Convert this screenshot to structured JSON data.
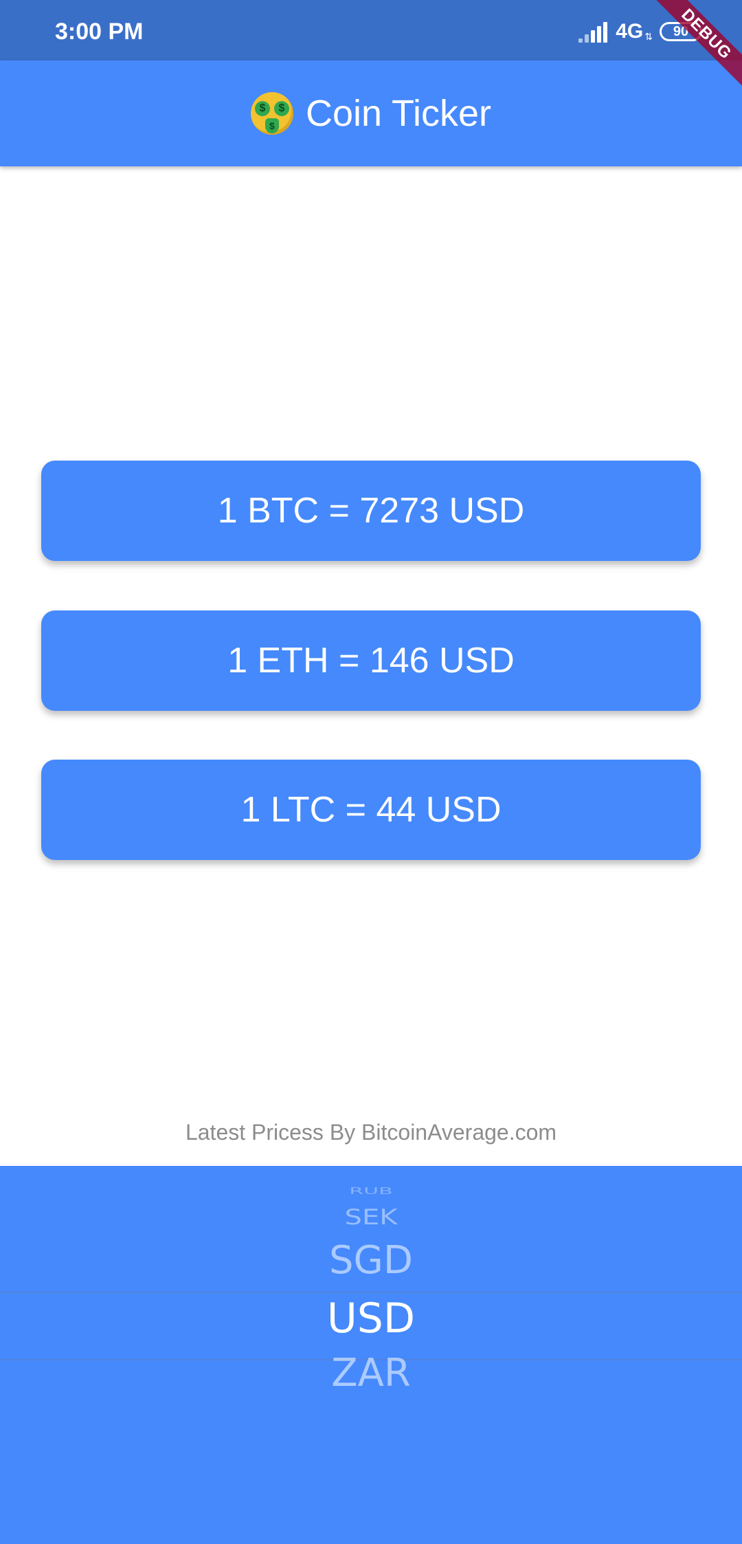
{
  "status_bar": {
    "time": "3:00 PM",
    "network": "4G",
    "battery": "90",
    "icons": [
      "signal-icon",
      "data-arrows-icon",
      "battery-icon"
    ]
  },
  "debug_banner": {
    "label": "DEBUG"
  },
  "app_bar": {
    "emoji": "money-mouth-face-icon",
    "title": "Coin Ticker"
  },
  "rates": [
    {
      "label": "1 BTC = 7273 USD"
    },
    {
      "label": "1 ETH = 146 USD"
    },
    {
      "label": "1 LTC = 44 USD"
    }
  ],
  "attribution": "Latest Pricess By BitcoinAverage.com",
  "currency_picker": {
    "items": [
      "RUB",
      "SEK",
      "SGD",
      "USD",
      "ZAR"
    ],
    "selected": "USD"
  },
  "colors": {
    "status_bar": "#3a6fc8",
    "primary": "#4589fc",
    "background": "#ffffff",
    "attribution_text": "#8c8c8c",
    "debug_ribbon": "#a00028"
  }
}
